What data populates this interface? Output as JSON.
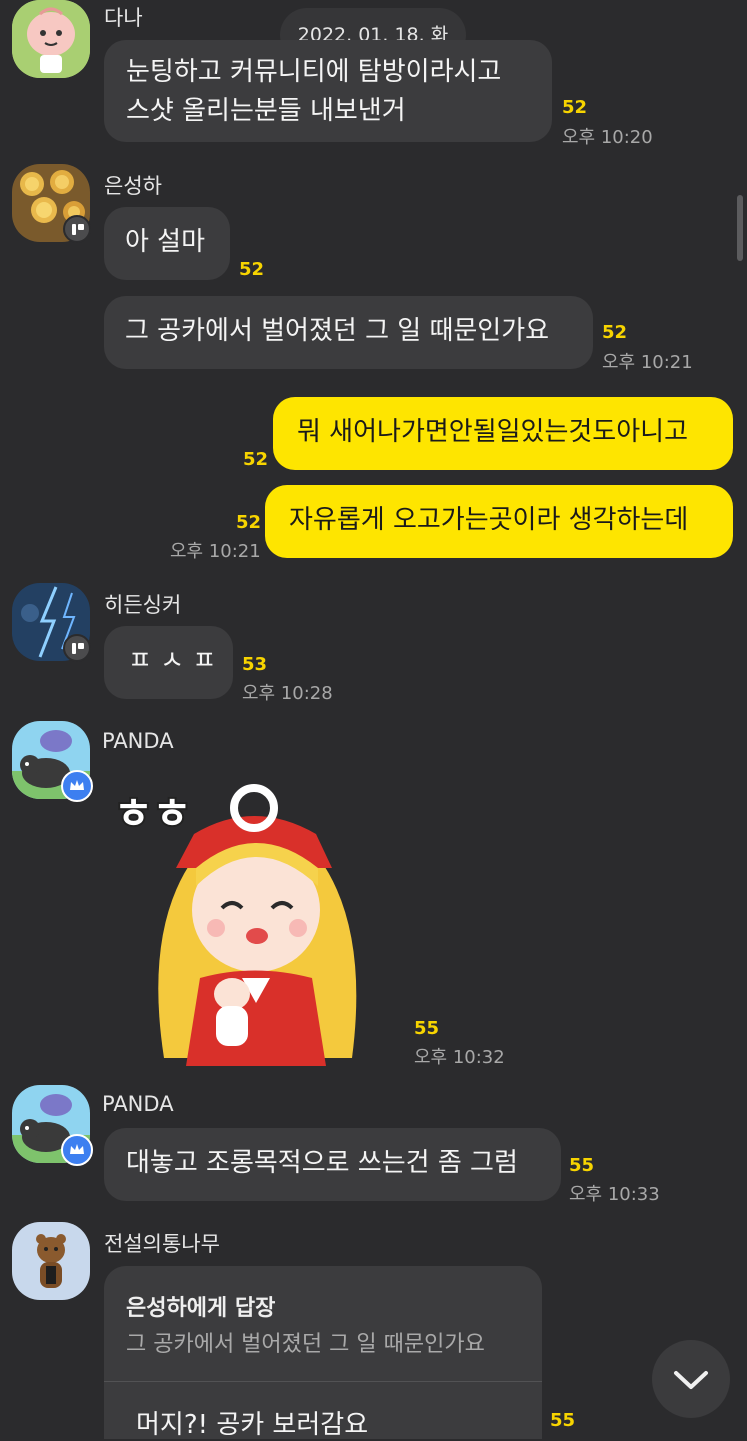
{
  "date_divider": "2022. 01. 18. 화",
  "messages": [
    {
      "sender": "다나",
      "lines": [
        "눈팅하고 커뮤니티에 탐방이라시고",
        "스샷 올리는분들 내보낸거"
      ],
      "unread": "52",
      "time": "오후 10:20"
    },
    {
      "sender": "은성하",
      "text": "아 설마",
      "unread": "52"
    },
    {
      "text": "그 공카에서 벌어졌던 그 일 때문인가요",
      "unread": "52",
      "time": "오후 10:21"
    },
    {
      "mine": true,
      "text": "뭐 새어나가면안될일있는것도아니고",
      "unread": "52"
    },
    {
      "mine": true,
      "text": "자유롭게 오고가는곳이라 생각하는데",
      "unread": "52",
      "time": "오후 10:21"
    },
    {
      "sender": "히든싱커",
      "text": "ㅍ ㅅ ㅍ",
      "unread": "53",
      "time": "오후 10:28"
    },
    {
      "sender": "PANDA",
      "sticker": "blonde-girl-sticker",
      "sticker_text": "ㅎㅎ",
      "unread": "55",
      "time": "오후 10:32"
    },
    {
      "sender": "PANDA",
      "text": "대놓고 조롱목적으로 쓰는건 좀 그럼",
      "unread": "55",
      "time": "오후 10:33"
    },
    {
      "sender": "전설의통나무",
      "reply_title": "은성하에게 답장",
      "reply_quote": "그 공카에서 벌어졌던 그 일 때문인가요",
      "text": "머지?! 공카 보러감요",
      "unread": "55"
    }
  ],
  "colors": {
    "background": "#2b2b2d",
    "bubble": "#3c3c3e",
    "my_bubble": "#fee500",
    "unread": "#f7d400"
  },
  "icons": {
    "scroll_down": "chevron-down-icon"
  }
}
